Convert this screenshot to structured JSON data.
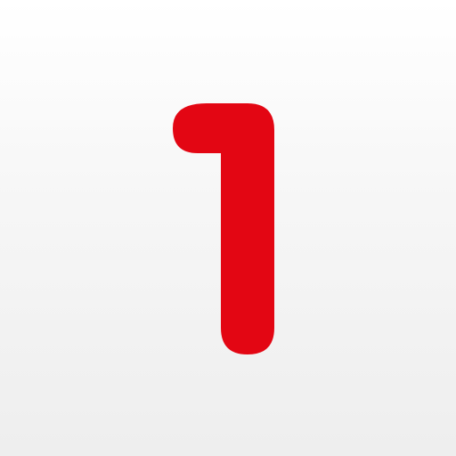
{
  "icon": {
    "name": "number-one-icon",
    "glyph_text": "1",
    "colors": {
      "background_top": "#ffffff",
      "background_bottom": "#eeeeee",
      "glyph": "#e30613"
    }
  }
}
